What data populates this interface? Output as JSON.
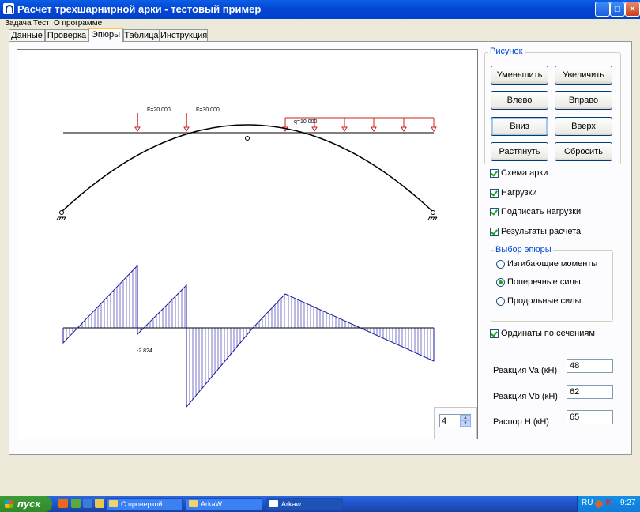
{
  "window": {
    "title": "Расчет трехшарнирной арки - тестовый пример"
  },
  "menu": {
    "items": [
      "Задача",
      "Тест",
      "О программе"
    ]
  },
  "tabs": [
    {
      "label": "Данные"
    },
    {
      "label": "Проверка"
    },
    {
      "label": "Эпюры",
      "active": true
    },
    {
      "label": "Таблица"
    },
    {
      "label": "Инструкция"
    }
  ],
  "diagram": {
    "load_f1": "F=20.000",
    "load_f2": "F=30.000",
    "load_q": "q=10.000",
    "ordinate_label": "-2.824",
    "colors": {
      "loads": "#CC2222",
      "epure": "#1A1AA0",
      "arch": "#000000"
    }
  },
  "spinner": {
    "value": "4"
  },
  "panel": {
    "group_title": "Рисунок",
    "buttons": {
      "shrink": "Уменьшить",
      "enlarge": "Увеличить",
      "left": "Влево",
      "right": "Вправо",
      "down": "Вниз",
      "up": "Вверх",
      "stretch": "Растянуть",
      "reset": "Сбросить"
    },
    "checkboxes": {
      "scheme": {
        "label": "Схема арки",
        "checked": true
      },
      "loads": {
        "label": "Нагрузки",
        "checked": true
      },
      "sign_loads": {
        "label": "Подписать нагрузки",
        "checked": true
      },
      "results": {
        "label": "Результаты расчета",
        "checked": true
      },
      "ordinates": {
        "label": "Ординаты по сечениям",
        "checked": true
      }
    },
    "epure": {
      "title": "Выбор эпюры",
      "options": [
        {
          "label": "Изгибающие моменты",
          "selected": false
        },
        {
          "label": "Поперечные силы",
          "selected": true
        },
        {
          "label": "Продольные силы",
          "selected": false
        }
      ]
    },
    "reactions": {
      "va": {
        "label": "Реакция Va (кН)",
        "value": "48"
      },
      "vb": {
        "label": "Реакция Vb (кН)",
        "value": "62"
      },
      "h": {
        "label": "Распор H (кН)",
        "value": "65"
      }
    }
  },
  "taskbar": {
    "start": "пуск",
    "items": [
      {
        "label": "С проверкой"
      },
      {
        "label": "ArkaW"
      },
      {
        "label": "Arkaw",
        "active": true
      }
    ],
    "lang": "RU",
    "clock": "9:27"
  }
}
